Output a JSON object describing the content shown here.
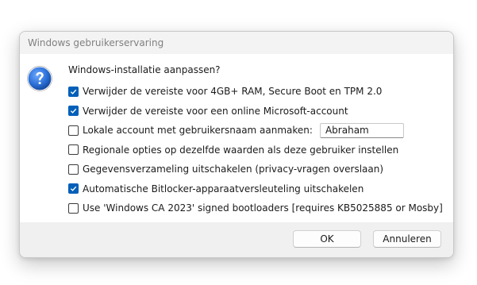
{
  "window": {
    "title": "Windows gebruikerservaring"
  },
  "icon": "question-mark-icon",
  "question": "Windows-installatie aanpassen?",
  "options": [
    {
      "label": "Verwijder de vereiste voor 4GB+ RAM, Secure Boot en TPM 2.0",
      "checked": true
    },
    {
      "label": "Verwijder de vereiste voor een online Microsoft-account",
      "checked": true
    },
    {
      "label": "Lokale account met gebruikersnaam aanmaken:",
      "checked": false
    },
    {
      "label": "Regionale opties op dezelfde waarden als deze gebruiker instellen",
      "checked": false
    },
    {
      "label": "Gegevensverzameling uitschakelen (privacy-vragen overslaan)",
      "checked": false
    },
    {
      "label": "Automatische Bitlocker-apparaatversleuteling uitschakelen",
      "checked": true
    },
    {
      "label": "Use 'Windows CA 2023' signed bootloaders [requires KB5025885 or Mosby]",
      "checked": false
    }
  ],
  "username": {
    "value": "Abraham"
  },
  "buttons": {
    "ok": "OK",
    "cancel": "Annuleren"
  },
  "colors": {
    "accent": "#005fb8",
    "icon_blue": "#1f5fbf"
  }
}
